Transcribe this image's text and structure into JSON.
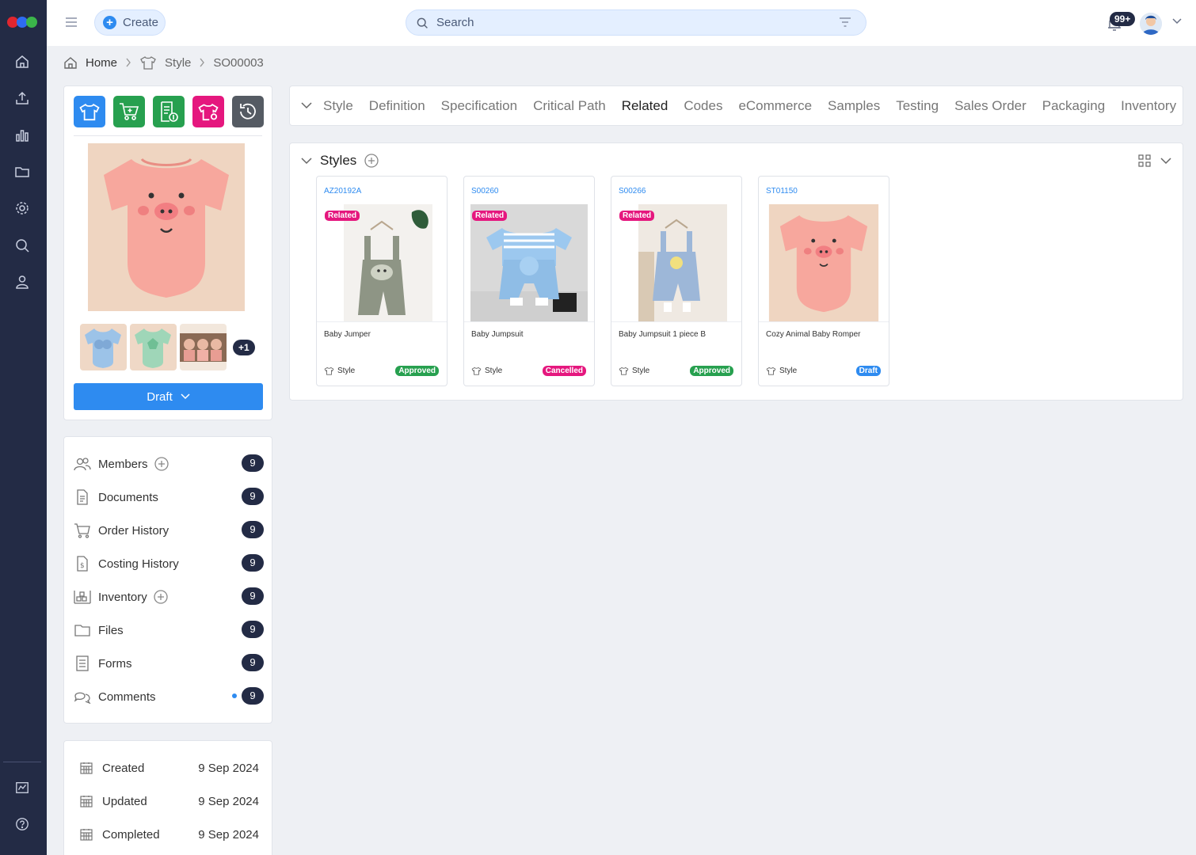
{
  "app": {
    "logo": "app-logo"
  },
  "rail": {
    "items": [
      "home-icon",
      "upload-icon",
      "bar-chart-icon",
      "folder-icon",
      "gear-icon",
      "search-icon",
      "user-icon"
    ],
    "bottom": [
      "chart-icon",
      "help-icon"
    ]
  },
  "topbar": {
    "create_label": "Create",
    "search_placeholder": "Search",
    "notifications": "99+"
  },
  "breadcrumb": {
    "home": "Home",
    "section": "Style",
    "current": "SO00003"
  },
  "product": {
    "status_button": "Draft",
    "more_images": "+1",
    "colors": {
      "shirt": "#2e8bf0",
      "cart": "#27a04f",
      "doc": "#27a04f",
      "pink": "#e5177e",
      "history": "#555b63"
    }
  },
  "nav": [
    {
      "label": "Members",
      "count": "9",
      "icon": "members-icon",
      "add": true
    },
    {
      "label": "Documents",
      "count": "9",
      "icon": "document-icon",
      "add": false
    },
    {
      "label": "Order History",
      "count": "9",
      "icon": "cart-icon",
      "add": false
    },
    {
      "label": "Costing History",
      "count": "9",
      "icon": "costing-icon",
      "add": false
    },
    {
      "label": "Inventory",
      "count": "9",
      "icon": "inventory-icon",
      "add": true
    },
    {
      "label": "Files",
      "count": "9",
      "icon": "folder-icon",
      "add": false
    },
    {
      "label": "Forms",
      "count": "9",
      "icon": "form-icon",
      "add": false
    },
    {
      "label": "Comments",
      "count": "9",
      "icon": "comments-icon",
      "add": false
    }
  ],
  "dates": [
    {
      "label": "Created",
      "value": "9 Sep 2024"
    },
    {
      "label": "Updated",
      "value": "9 Sep 2024"
    },
    {
      "label": "Completed",
      "value": "9 Sep 2024"
    }
  ],
  "tabs": [
    "Style",
    "Definition",
    "Specification",
    "Critical Path",
    "Related",
    "Codes",
    "eCommerce",
    "Samples",
    "Testing",
    "Sales Order",
    "Packaging",
    "Inventory"
  ],
  "active_tab": "Related",
  "styles_panel": {
    "title": "Styles",
    "cards": [
      {
        "code": "AZ20192A",
        "name": "Baby Jumper",
        "type": "Style",
        "status": "Approved",
        "status_color": "#27a04f",
        "related": "Related"
      },
      {
        "code": "S00260",
        "name": "Baby Jumpsuit",
        "type": "Style",
        "status": "Cancelled",
        "status_color": "#e5177e",
        "related": "Related"
      },
      {
        "code": "S00266",
        "name": "Baby Jumpsuit 1 piece B",
        "type": "Style",
        "status": "Approved",
        "status_color": "#27a04f",
        "related": "Related"
      },
      {
        "code": "ST01150",
        "name": "Cozy Animal Baby Romper",
        "type": "Style",
        "status": "Draft",
        "status_color": "#2e8bf0",
        "related": ""
      }
    ]
  }
}
